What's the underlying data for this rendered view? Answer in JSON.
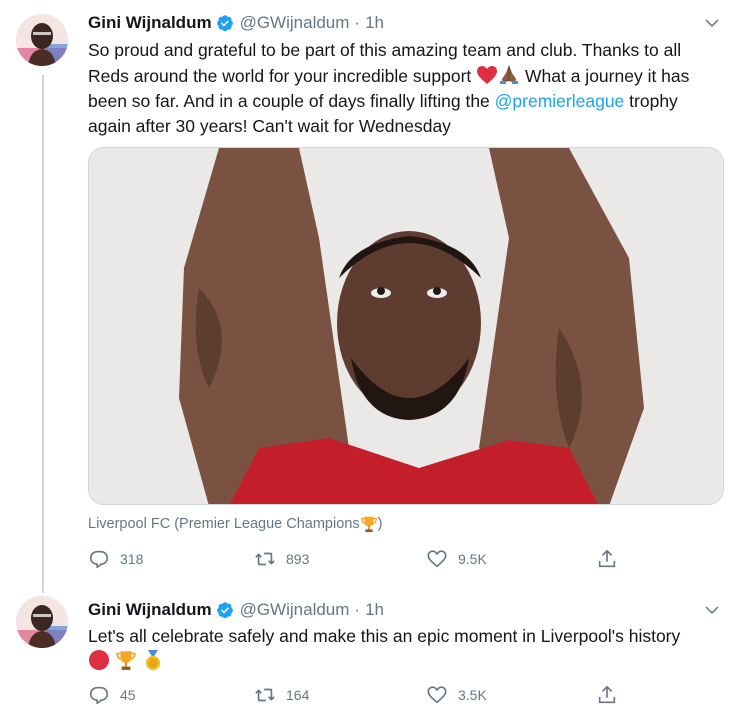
{
  "tweets": [
    {
      "author": {
        "name": "Gini Wijnaldum",
        "handle": "@GWijnaldum",
        "time": "1h"
      },
      "text": {
        "part1": "So proud and grateful to be part of this amazing team and club. Thanks to all Reds around the world for your incredible support ",
        "part2": " What a journey it has been so far. And in a couple of days finally lifting the ",
        "mention": "@premierleague",
        "part3": " trophy again after 30 years! Can't wait for Wednesday"
      },
      "media_credit": "Liverpool FC (Premier League Champions ",
      "media_credit_end": ")",
      "stats": {
        "replies": "318",
        "retweets": "893",
        "likes": "9.5K"
      }
    },
    {
      "author": {
        "name": "Gini Wijnaldum",
        "handle": "@GWijnaldum",
        "time": "1h"
      },
      "text": {
        "part1": "Let's all celebrate safely and make this an epic moment in Liverpool's history"
      },
      "stats": {
        "replies": "45",
        "retweets": "164",
        "likes": "3.5K"
      }
    }
  ],
  "colors": {
    "accent": "#1da1f2",
    "muted": "#657786",
    "border": "#ccd6dd",
    "lfc_red": "#d3101f"
  },
  "icons": [
    "verified-badge-icon",
    "chevron-down-icon",
    "reply-icon",
    "retweet-icon",
    "like-icon",
    "share-icon",
    "red-heart-emoji",
    "praying-hands-emoji",
    "red-circle-emoji",
    "trophy-emoji",
    "medal-emoji"
  ]
}
